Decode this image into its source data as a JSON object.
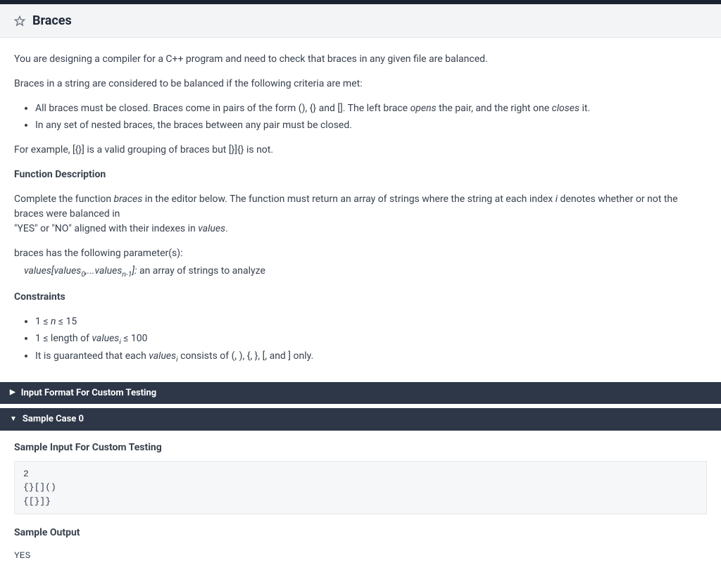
{
  "header": {
    "title": "Braces"
  },
  "body": {
    "intro": "You are designing a compiler for a C++ program and need to check that braces in any given file are balanced.",
    "criteria_intro": "Braces in a string are considered to be balanced if the following criteria are met:",
    "criteria": [
      "All braces must be closed. Braces come in pairs of the form (), {} and [].  The left brace ",
      "In any set of nested braces, the braces between any pair must be closed."
    ],
    "criteria1_opens": "opens",
    "criteria1_mid": " the pair, and the right one ",
    "criteria1_closes": "closes",
    "criteria1_end": " it.",
    "example": "For example, [{}] is a valid grouping of braces but [}]{} is not.",
    "func_desc_head": "Function Description",
    "func_desc_1a": "Complete the function ",
    "func_desc_1b": "braces",
    "func_desc_1c": " in the editor below. The function must return an array of strings where the string at each index ",
    "func_desc_1d": "i",
    "func_desc_1e": " denotes whether or not the braces were balanced in ",
    "func_desc_2a": "\"YES\" or \"NO\" aligned with their indexes in ",
    "func_desc_2b": "values",
    "func_desc_2c": ".",
    "params_intro": "braces has the following parameter(s):",
    "param_name_a": "values[values",
    "param_name_b": ",...values",
    "param_name_c": "]:",
    "param_sub0": "0",
    "param_subn": "n-1",
    "param_desc": "  an array of strings to analyze",
    "constraints_head": "Constraints",
    "constraint1_a": "1 ≤ ",
    "constraint1_b": "n",
    "constraint1_c": " ≤ 15",
    "constraint2_a": "1 ≤ length of ",
    "constraint2_b": "values",
    "constraint2_sub": "i",
    "constraint2_c": " ≤ 100",
    "constraint3_a": "It is guaranteed that each ",
    "constraint3_b": "values",
    "constraint3_sub": "i",
    "constraint3_c": " consists of (, ), {, }, [, and ] only."
  },
  "accordions": {
    "input_format": "Input Format For Custom Testing",
    "sample_case0": "Sample Case 0"
  },
  "sample": {
    "input_head": "Sample Input For Custom Testing",
    "input_code": "2\n{}[]()\n{[}]}",
    "output_head": "Sample Output",
    "output_code": "YES"
  }
}
